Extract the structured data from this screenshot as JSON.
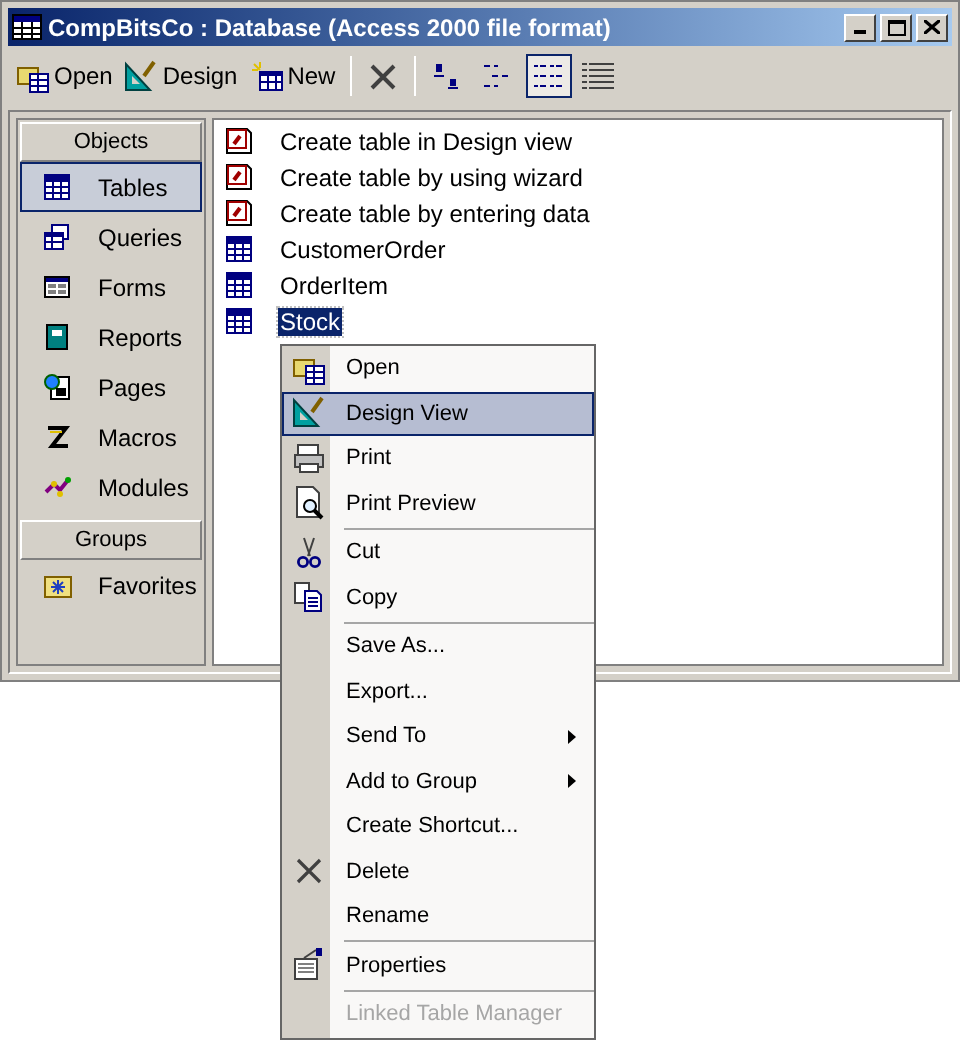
{
  "window": {
    "title": "CompBitsCo : Database (Access 2000 file format)"
  },
  "toolbar": {
    "buttons": [
      {
        "label": "Open",
        "kind": "open"
      },
      {
        "label": "Design",
        "kind": "design"
      },
      {
        "label": "New",
        "kind": "new"
      },
      {
        "kind": "delete"
      }
    ],
    "views": [
      {
        "kind": "large",
        "selected": false
      },
      {
        "kind": "small",
        "selected": false
      },
      {
        "kind": "list",
        "selected": true
      },
      {
        "kind": "details",
        "selected": false
      }
    ]
  },
  "sidebar": {
    "header": "Objects",
    "items": [
      {
        "label": "Tables",
        "kind": "tables",
        "selected": true
      },
      {
        "label": "Queries",
        "kind": "queries",
        "selected": false
      },
      {
        "label": "Forms",
        "kind": "forms",
        "selected": false
      },
      {
        "label": "Reports",
        "kind": "reports",
        "selected": false
      },
      {
        "label": "Pages",
        "kind": "pages",
        "selected": false
      },
      {
        "label": "Macros",
        "kind": "macros",
        "selected": false
      },
      {
        "label": "Modules",
        "kind": "modules",
        "selected": false
      }
    ],
    "groups_header": "Groups",
    "groups": [
      {
        "label": "Favorites",
        "kind": "favorites",
        "selected": false
      }
    ]
  },
  "list": {
    "items": [
      {
        "label": "Create table in Design view",
        "kind": "shortcut",
        "selected": false
      },
      {
        "label": "Create table by using wizard",
        "kind": "shortcut",
        "selected": false
      },
      {
        "label": "Create table by entering data",
        "kind": "shortcut",
        "selected": false
      },
      {
        "label": "CustomerOrder",
        "kind": "table",
        "selected": false
      },
      {
        "label": "OrderItem",
        "kind": "table",
        "selected": false
      },
      {
        "label": "Stock",
        "kind": "table",
        "selected": true
      }
    ]
  },
  "context_menu": {
    "items": [
      {
        "label": "Open",
        "kind": "open",
        "selected": false,
        "disabled": false,
        "submenu": false
      },
      {
        "label": "Design View",
        "kind": "design",
        "selected": true,
        "disabled": false,
        "submenu": false
      },
      {
        "label": "Print",
        "kind": "print",
        "selected": false,
        "disabled": false,
        "submenu": false
      },
      {
        "label": "Print Preview",
        "kind": "preview",
        "selected": false,
        "disabled": false,
        "submenu": false
      },
      {
        "kind": "separator"
      },
      {
        "label": "Cut",
        "kind": "cut",
        "selected": false,
        "disabled": false,
        "submenu": false
      },
      {
        "label": "Copy",
        "kind": "copy",
        "selected": false,
        "disabled": false,
        "submenu": false
      },
      {
        "kind": "separator"
      },
      {
        "label": "Save As...",
        "kind": "plain",
        "selected": false,
        "disabled": false,
        "submenu": false
      },
      {
        "label": "Export...",
        "kind": "plain",
        "selected": false,
        "disabled": false,
        "submenu": false
      },
      {
        "label": "Send To",
        "kind": "plain",
        "selected": false,
        "disabled": false,
        "submenu": true
      },
      {
        "label": "Add to Group",
        "kind": "plain",
        "selected": false,
        "disabled": false,
        "submenu": true
      },
      {
        "label": "Create Shortcut...",
        "kind": "plain",
        "selected": false,
        "disabled": false,
        "submenu": false
      },
      {
        "label": "Delete",
        "kind": "delete",
        "selected": false,
        "disabled": false,
        "submenu": false
      },
      {
        "label": "Rename",
        "kind": "plain",
        "selected": false,
        "disabled": false,
        "submenu": false
      },
      {
        "kind": "separator"
      },
      {
        "label": "Properties",
        "kind": "properties",
        "selected": false,
        "disabled": false,
        "submenu": false
      },
      {
        "kind": "separator"
      },
      {
        "label": "Linked Table Manager",
        "kind": "plain",
        "selected": false,
        "disabled": true,
        "submenu": false
      }
    ]
  }
}
